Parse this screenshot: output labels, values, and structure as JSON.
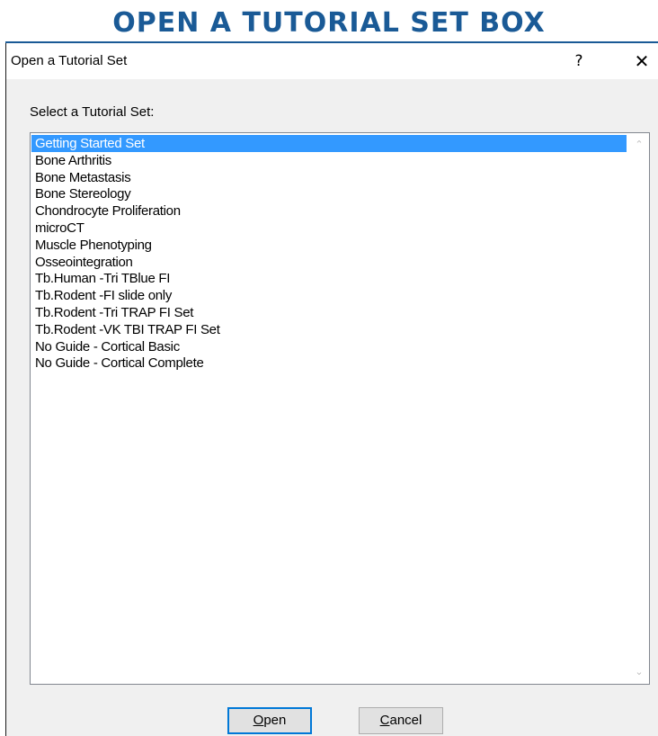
{
  "banner": {
    "title": "OPEN A TUTORIAL SET BOX"
  },
  "dialog": {
    "title": "Open a Tutorial Set",
    "help_glyph": "?",
    "close_glyph": "✕",
    "prompt": "Select a Tutorial Set:",
    "list": {
      "selected_index": 0,
      "items": [
        "Getting Started Set",
        "Bone Arthritis",
        "Bone Metastasis",
        "Bone Stereology",
        "Chondrocyte Proliferation",
        "microCT",
        "Muscle Phenotyping",
        "Osseointegration",
        "Tb.Human -Tri TBlue FI",
        "Tb.Rodent -FI slide only",
        "Tb.Rodent -Tri TRAP FI Set",
        "Tb.Rodent -VK TBI TRAP FI Set",
        "No Guide - Cortical Basic",
        "No Guide - Cortical Complete"
      ]
    },
    "scroll": {
      "up_glyph": "⌃",
      "down_glyph": "⌄"
    },
    "buttons": {
      "open": {
        "mnemonic": "O",
        "rest": "pen"
      },
      "cancel": {
        "mnemonic": "C",
        "rest": "ancel"
      }
    }
  },
  "icons": {
    "help": "help-icon",
    "close": "close-icon",
    "scroll_up": "chevron-up-icon",
    "scroll_down": "chevron-down-icon"
  },
  "colors": {
    "banner": "#1a5a96",
    "selection": "#3399ff",
    "dialog_bg": "#f0f0f0",
    "default_button_border": "#0078d7"
  }
}
